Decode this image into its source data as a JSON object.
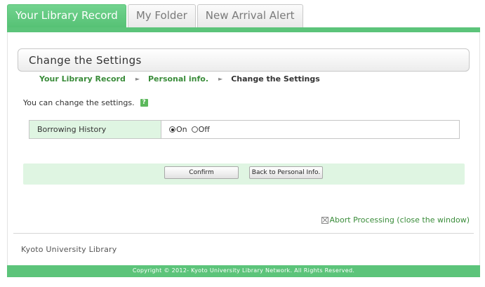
{
  "tabs": [
    {
      "label": "Your Library Record",
      "active": true
    },
    {
      "label": "My Folder",
      "active": false
    },
    {
      "label": "New Arrival Alert",
      "active": false
    }
  ],
  "page": {
    "title": "Change the Settings",
    "breadcrumb": {
      "items": [
        "Your Library Record",
        "Personal info."
      ],
      "current": "Change the Settings",
      "separator": "►"
    },
    "note": "You can change the settings.",
    "help_icon": "?"
  },
  "settings": {
    "label": "Borrowing History",
    "options": [
      {
        "label": "On",
        "checked": true
      },
      {
        "label": "Off",
        "checked": false
      }
    ]
  },
  "buttons": {
    "confirm": "Confirm",
    "back": "Back to Personal Info."
  },
  "abort": {
    "label": "Abort Processing (close the window)",
    "icon": "close-box-icon"
  },
  "library_name": "Kyoto University Library",
  "footer": "Copyright © 2012- Kyoto University Library Network. All Rights Reserved.",
  "colors": {
    "accent": "#5cc47a",
    "light_green": "#dff5e2",
    "link": "#3a8c3a"
  }
}
